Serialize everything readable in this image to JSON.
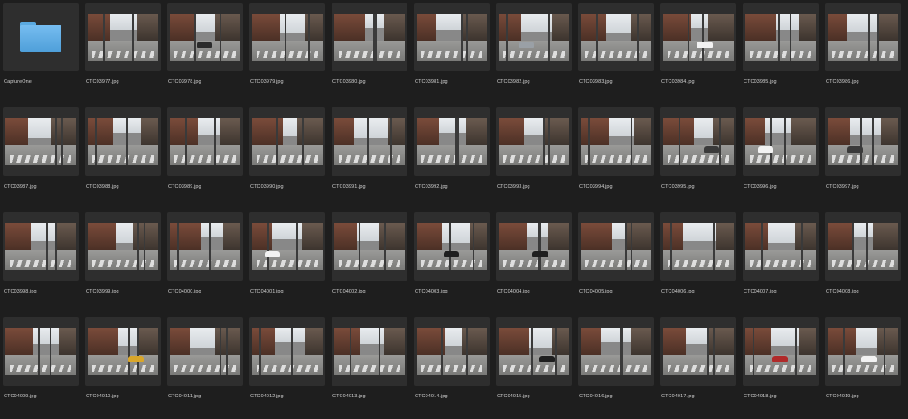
{
  "browser": {
    "items": [
      {
        "name": "CaptureOne",
        "kind": "folder",
        "icon": "folder-icon"
      },
      {
        "name": "CTC03977.jpg",
        "kind": "image",
        "car": ""
      },
      {
        "name": "CTC03978.jpg",
        "kind": "image",
        "car": "#2b2b2b"
      },
      {
        "name": "CTC03979.jpg",
        "kind": "image",
        "car": ""
      },
      {
        "name": "CTC03980.jpg",
        "kind": "image",
        "car": ""
      },
      {
        "name": "CTC03981.jpg",
        "kind": "image",
        "car": ""
      },
      {
        "name": "CTC03982.jpg",
        "kind": "image",
        "car": "#9aa0a6"
      },
      {
        "name": "CTC03983.jpg",
        "kind": "image",
        "car": ""
      },
      {
        "name": "CTC03984.jpg",
        "kind": "image",
        "car": "#f2f2f2"
      },
      {
        "name": "CTC03985.jpg",
        "kind": "image",
        "car": ""
      },
      {
        "name": "CTC03986.jpg",
        "kind": "image",
        "car": ""
      },
      {
        "name": "CTC03987.jpg",
        "kind": "image",
        "car": ""
      },
      {
        "name": "CTC03988.jpg",
        "kind": "image",
        "car": ""
      },
      {
        "name": "CTC03989.jpg",
        "kind": "image",
        "car": ""
      },
      {
        "name": "CTC03990.jpg",
        "kind": "image",
        "car": ""
      },
      {
        "name": "CTC03991.jpg",
        "kind": "image",
        "car": ""
      },
      {
        "name": "CTC03992.jpg",
        "kind": "image",
        "car": ""
      },
      {
        "name": "CTC03993.jpg",
        "kind": "image",
        "car": ""
      },
      {
        "name": "CTC03994.jpg",
        "kind": "image",
        "car": ""
      },
      {
        "name": "CTC03995.jpg",
        "kind": "image",
        "car": "#3a3a3a"
      },
      {
        "name": "CTC03996.jpg",
        "kind": "image",
        "car": "#f2f2f2"
      },
      {
        "name": "CTC03997.jpg",
        "kind": "image",
        "car": "#3a3a3a"
      },
      {
        "name": "CTC03998.jpg",
        "kind": "image",
        "car": ""
      },
      {
        "name": "CTC03999.jpg",
        "kind": "image",
        "car": ""
      },
      {
        "name": "CTC04000.jpg",
        "kind": "image",
        "car": ""
      },
      {
        "name": "CTC04001.jpg",
        "kind": "image",
        "car": "#f2f2f2"
      },
      {
        "name": "CTC04002.jpg",
        "kind": "image",
        "car": ""
      },
      {
        "name": "CTC04003.jpg",
        "kind": "image",
        "car": "#1f1f1f"
      },
      {
        "name": "CTC04004.jpg",
        "kind": "image",
        "car": "#1f1f1f"
      },
      {
        "name": "CTC04005.jpg",
        "kind": "image",
        "car": ""
      },
      {
        "name": "CTC04006.jpg",
        "kind": "image",
        "car": ""
      },
      {
        "name": "CTC04007.jpg",
        "kind": "image",
        "car": ""
      },
      {
        "name": "CTC04008.jpg",
        "kind": "image",
        "car": ""
      },
      {
        "name": "CTC04009.jpg",
        "kind": "image",
        "car": ""
      },
      {
        "name": "CTC04010.jpg",
        "kind": "image",
        "car": "#d9a62a"
      },
      {
        "name": "CTC04011.jpg",
        "kind": "image",
        "car": ""
      },
      {
        "name": "CTC04012.jpg",
        "kind": "image",
        "car": ""
      },
      {
        "name": "CTC04013.jpg",
        "kind": "image",
        "car": ""
      },
      {
        "name": "CTC04014.jpg",
        "kind": "image",
        "car": ""
      },
      {
        "name": "CTC04015.jpg",
        "kind": "image",
        "car": "#1f1f1f"
      },
      {
        "name": "CTC04016.jpg",
        "kind": "image",
        "car": ""
      },
      {
        "name": "CTC04017.jpg",
        "kind": "image",
        "car": ""
      },
      {
        "name": "CTC04018.jpg",
        "kind": "image",
        "car": "#b02a2a"
      },
      {
        "name": "CTC04019.jpg",
        "kind": "image",
        "car": "#f2f2f2"
      }
    ]
  }
}
